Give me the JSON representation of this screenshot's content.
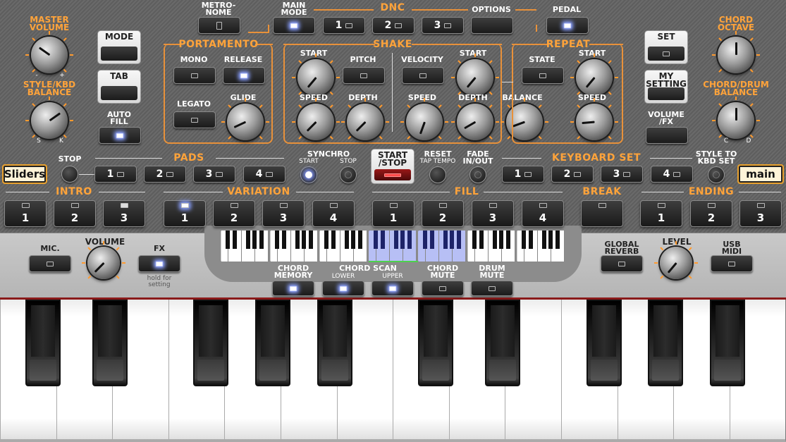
{
  "colors": {
    "accent": "#ffa33a",
    "led_on": "#8aa0ff",
    "panel": "#6a6a6a",
    "lower_panel": "#c2c2c2",
    "side_button": "#fff4d8"
  },
  "top": {
    "master_volume": "MASTER\nVOLUME",
    "style_kbd_balance": "STYLE/KBD\nBALANCE",
    "balance_left": "S",
    "balance_right": "K",
    "vol_minus": "-",
    "vol_plus": "+",
    "mode": "MODE",
    "tab": "TAB",
    "auto_fill": "AUTO\nFILL",
    "metronome": "METRO-\nNOME",
    "main_mode": "MAIN\nMODE",
    "dnc": "DNC",
    "options": "OPTIONS",
    "pedal": "PEDAL",
    "dnc_buttons": [
      "1",
      "2",
      "3"
    ],
    "set": "SET",
    "my_setting": "MY\nSETTING",
    "volume_fx": "VOLUME\n/FX",
    "chord_octave": "CHORD\nOCTAVE",
    "chord_drum_balance": "CHORD/DRUM\nBALANCE",
    "cd_left": "C",
    "cd_right": "D"
  },
  "portamento": {
    "title": "PORTAMENTO",
    "mono": "MONO",
    "release": "RELEASE",
    "legato": "LEGATO",
    "glide": "GLIDE"
  },
  "shake": {
    "title": "SHAKE",
    "start": "START",
    "pitch": "PITCH",
    "speed": "SPEED",
    "depth": "DEPTH",
    "velocity": "VELOCITY",
    "start2": "START",
    "speed2": "SPEED",
    "depth2": "DEPTH",
    "balance": "BALANCE"
  },
  "repeat": {
    "title": "REPEAT",
    "state": "STATE",
    "start": "START",
    "speed": "SPEED"
  },
  "middle": {
    "sliders": "Sliders",
    "main": "main",
    "stop": "STOP",
    "pads": "PADS",
    "pad_buttons": [
      "1",
      "2",
      "3",
      "4"
    ],
    "synchro": "SYNCHRO",
    "synchro_start": "START",
    "synchro_stop": "STOP",
    "start_stop": "START\n/STOP",
    "reset": "RESET",
    "tap_tempo": "TAP TEMPO",
    "fade": "FADE\nIN/OUT",
    "keyboard_set": "KEYBOARD SET",
    "kbd_buttons": [
      "1",
      "2",
      "3",
      "4"
    ],
    "style_to_kbd": "STYLE TO\nKBD SET"
  },
  "sections": {
    "intro": "INTRO",
    "intro_buttons": [
      "1",
      "2",
      "3"
    ],
    "variation": "VARIATION",
    "variation_buttons": [
      "1",
      "2",
      "3",
      "4"
    ],
    "fill": "FILL",
    "fill_buttons": [
      "1",
      "2",
      "3",
      "4"
    ],
    "break": "BREAK",
    "ending": "ENDING",
    "ending_buttons": [
      "1",
      "2",
      "3"
    ]
  },
  "lower": {
    "mic": "MIC.",
    "volume": "VOLUME",
    "fx": "FX",
    "fx_hint": "hold for\nsetting",
    "chord_memory": "CHORD\nMEMORY",
    "chord_scan": "CHORD SCAN",
    "lower": "LOWER",
    "upper": "UPPER",
    "chord_mute": "CHORD\nMUTE",
    "drum_mute": "DRUM\nMUTE",
    "global_reverb": "GLOBAL\nREVERB",
    "level": "LEVEL",
    "usb_midi": "USB\nMIDI"
  }
}
